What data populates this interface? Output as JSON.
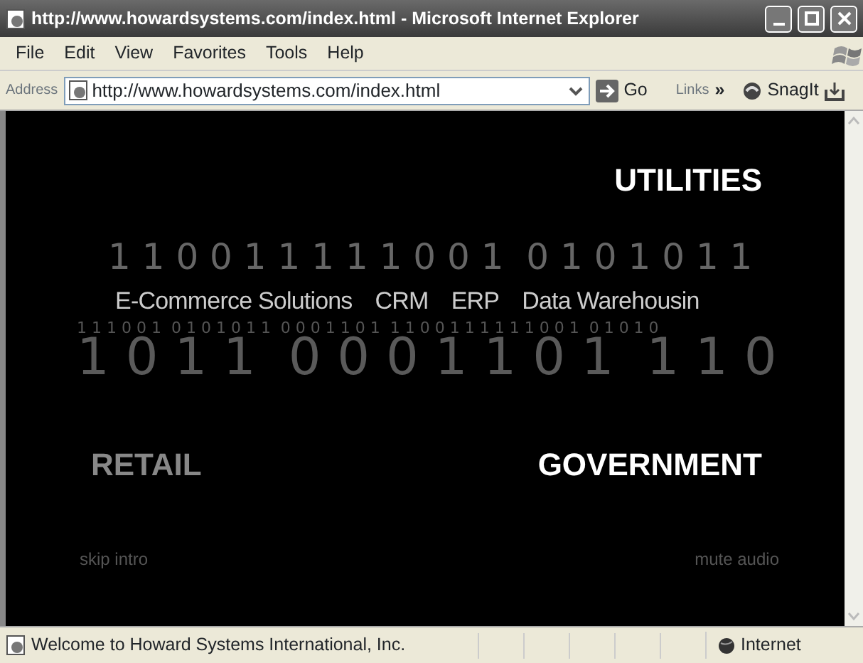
{
  "window": {
    "title": "http://www.howardsystems.com/index.html - Microsoft Internet Explorer"
  },
  "menu": [
    "File",
    "Edit",
    "View",
    "Favorites",
    "Tools",
    "Help"
  ],
  "address_bar": {
    "label": "Address",
    "value": "http://www.howardsystems.com/index.html",
    "go": "Go",
    "links": "Links",
    "chevron": "»",
    "toolbar_button": "SnagIt"
  },
  "intro": {
    "top_heading": {
      "label": "UTILITIES",
      "highlighted": true
    },
    "binary_top": {
      "kind": "medium",
      "text": "1 1 0 0 1 1 1 1 1 0 0 1  0 1 0 1 0 1 1"
    },
    "services": [
      "E-Commerce Solutions",
      "CRM",
      "ERP",
      "Data Warehousin"
    ],
    "binary_rows": [
      {
        "kind": "small",
        "text": "1 1 1 0 0 1  0 1 0 1 0 1 1  0 0 0 1 1 0 1  1 1 0 0 1 1 1 1 1 1 0 0 1  0 1 0 1 0"
      },
      {
        "kind": "large",
        "text": "1 0 1 1  0 0 0 1 1 0 1  1 1 0"
      }
    ],
    "bottom_headings": [
      {
        "label": "RETAIL",
        "highlighted": false
      },
      {
        "label": "GOVERNMENT",
        "highlighted": true
      }
    ],
    "links": [
      "skip intro",
      "mute audio"
    ]
  },
  "status_bar": {
    "text": "Welcome to Howard Systems International, Inc.",
    "zone": "Internet"
  }
}
